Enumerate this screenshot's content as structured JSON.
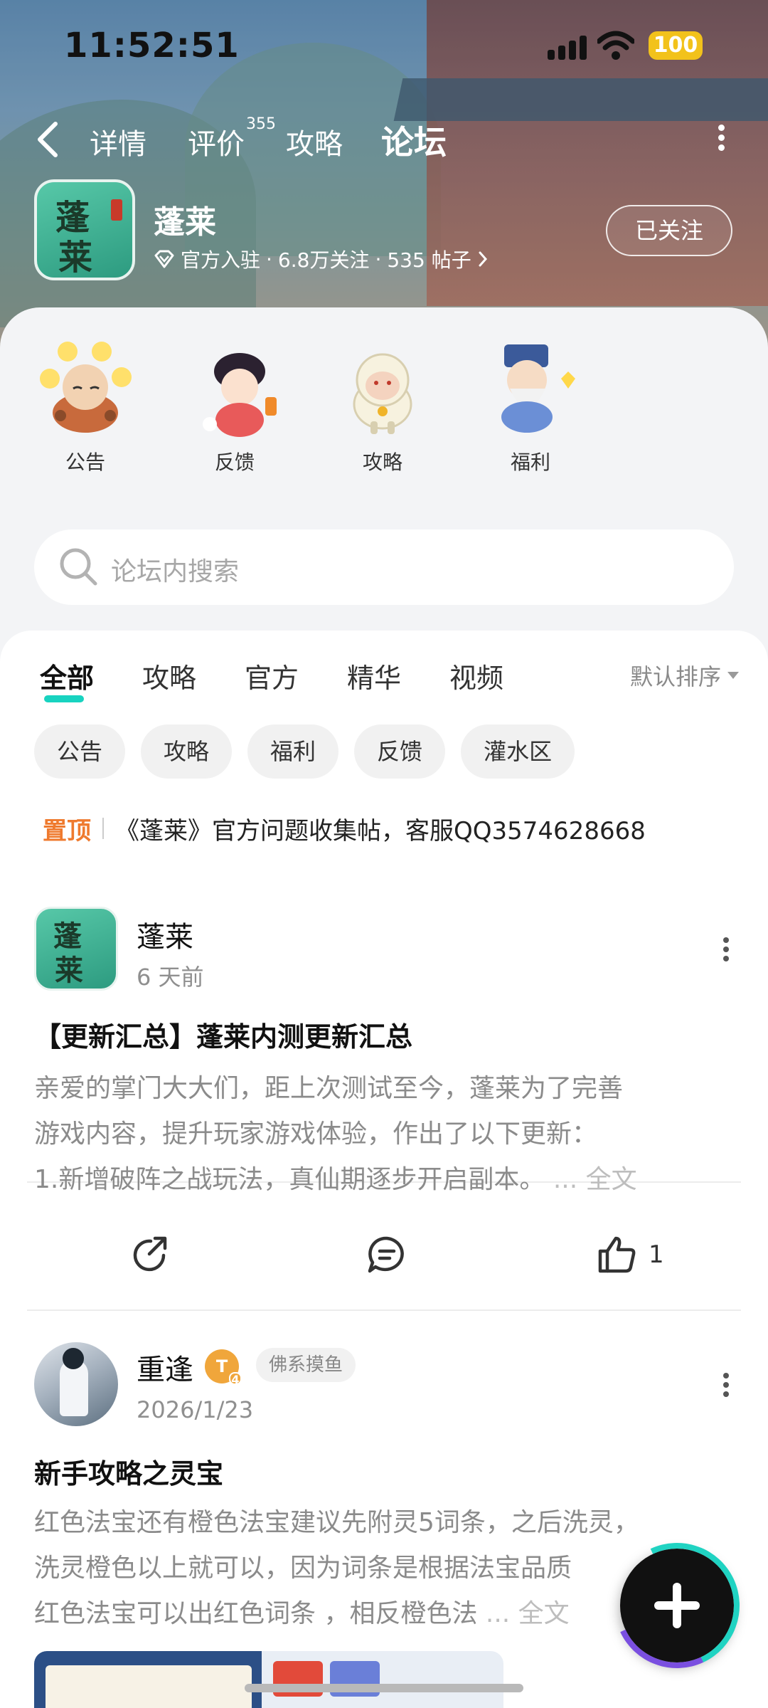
{
  "status": {
    "time": "11:52:51",
    "battery": "100"
  },
  "nav": {
    "tabs": [
      {
        "label": "详情"
      },
      {
        "label": "评价",
        "badge": "355"
      },
      {
        "label": "攻略"
      },
      {
        "label": "论坛"
      }
    ],
    "active_tab": "论坛"
  },
  "forum": {
    "name": "蓬莱",
    "icon_chars": [
      "蓬",
      "莱"
    ],
    "official": "官方入驻",
    "follows": "6.8万关注",
    "posts": "535 帖子",
    "follow_button": "已关注"
  },
  "quick_links": [
    {
      "label": "公告",
      "icon": "monk-mascot-icon"
    },
    {
      "label": "反馈",
      "icon": "moon-maiden-mascot-icon"
    },
    {
      "label": "攻略",
      "icon": "sheep-mascot-icon"
    },
    {
      "label": "福利",
      "icon": "elder-mascot-icon"
    }
  ],
  "search": {
    "placeholder": "论坛内搜索"
  },
  "feed_tabs": [
    "全部",
    "攻略",
    "官方",
    "精华",
    "视频"
  ],
  "feed_active_tab": "全部",
  "sort": {
    "label": "默认排序"
  },
  "chips": [
    "公告",
    "攻略",
    "福利",
    "反馈",
    "灌水区"
  ],
  "pinned": {
    "tag": "置顶",
    "text": "《蓬莱》官方问题收集帖，客服QQ3574628668"
  },
  "posts": [
    {
      "author": "蓬莱",
      "time": "6 天前",
      "title": "【更新汇总】蓬莱内测更新汇总",
      "body_lines": [
        "亲爱的掌门大大们，距上次测试至今，蓬莱为了完善",
        "游戏内容，提升玩家游戏体验，作出了以下更新：",
        "1.新增破阵之战玩法，真仙期逐步开启副本。"
      ],
      "more": "... 全文",
      "likes": "1"
    },
    {
      "author": "重逢",
      "level": "T",
      "level_sub": "4",
      "user_title": "佛系摸鱼",
      "time": "2026/1/23",
      "title": "新手攻略之灵宝",
      "body_lines": [
        "红色法宝还有橙色法宝建议先附灵5词条，之后洗灵，",
        "洗灵橙色以上就可以，因为词条是根据法宝品质",
        "红色法宝可以出红色词条 ，相反橙色法"
      ],
      "more": "... 全文"
    }
  ]
}
